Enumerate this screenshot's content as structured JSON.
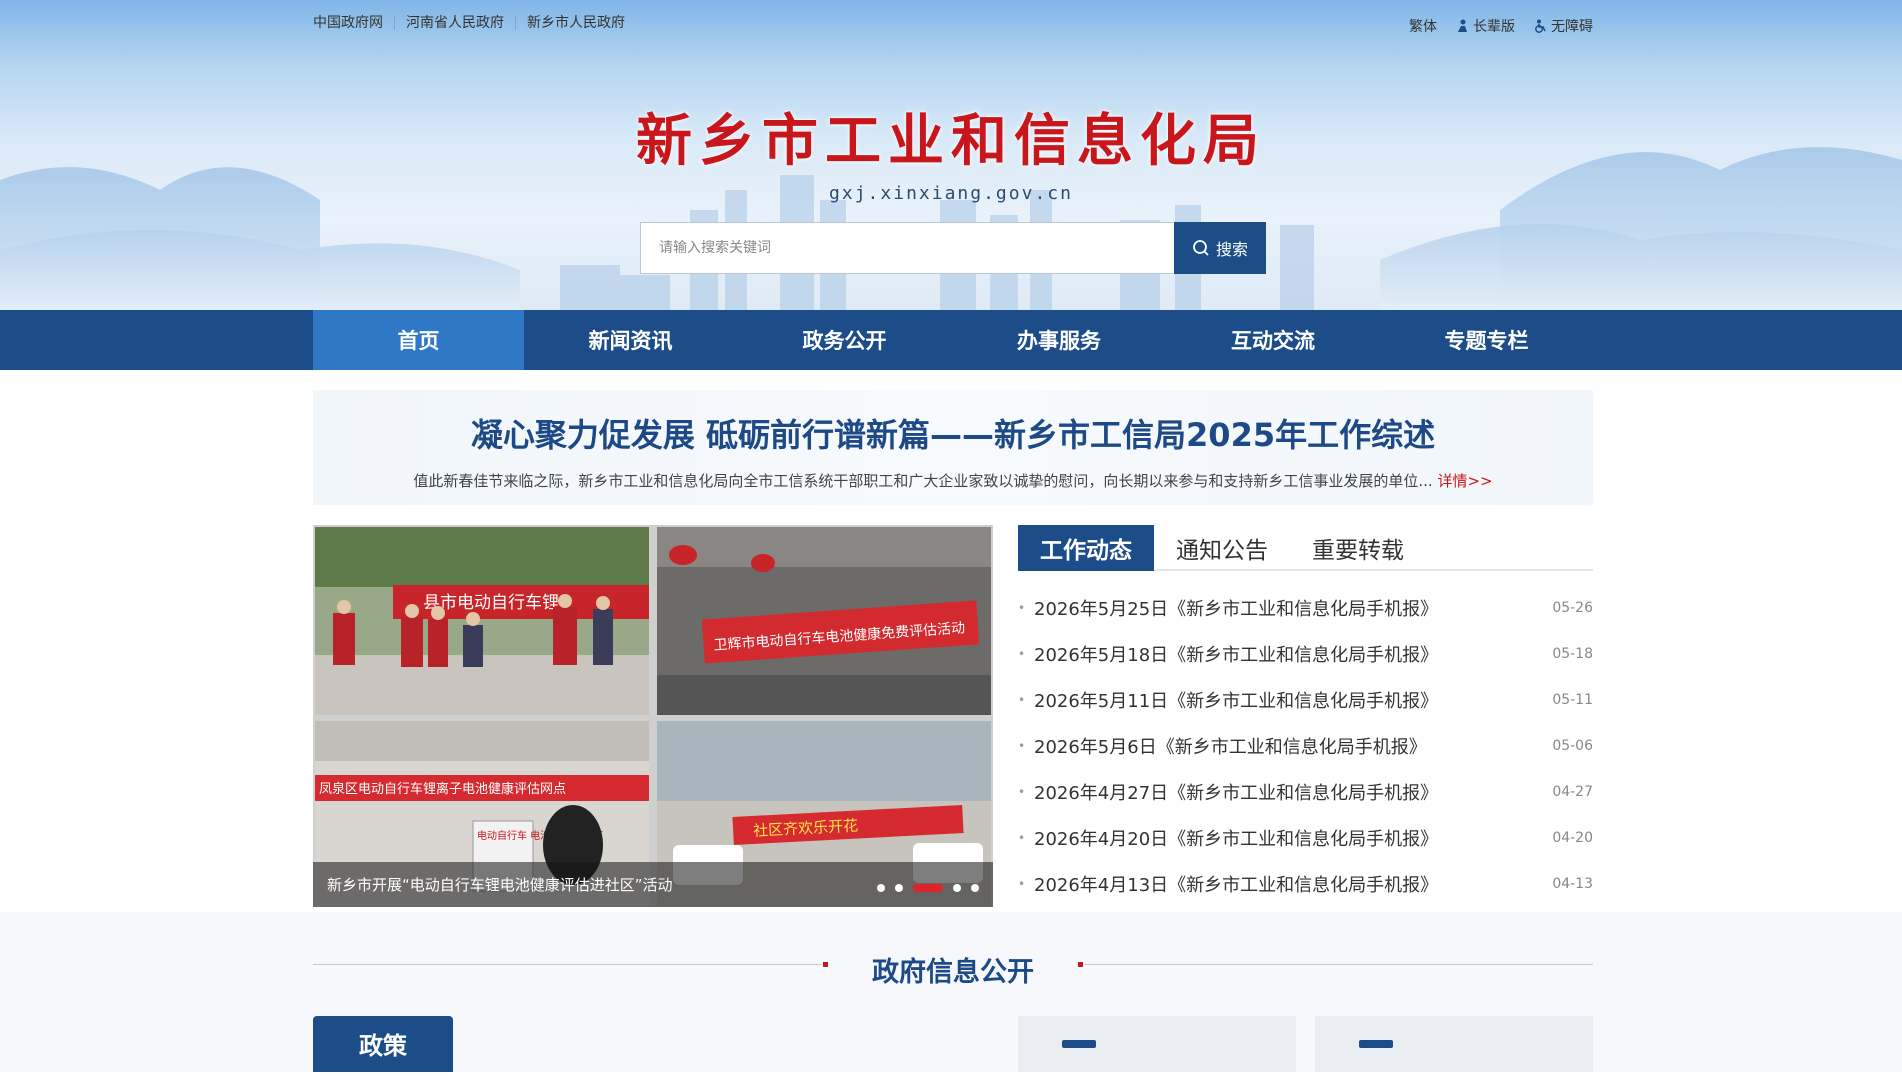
{
  "topbar": {
    "links": [
      "中国政府网",
      "河南省人民政府",
      "新乡市人民政府"
    ],
    "traditional": "繁体",
    "elder_mode": "长辈版",
    "accessibility": "无障碍"
  },
  "brand": {
    "title": "新乡市工业和信息化局",
    "domain": "gxj.xinxiang.gov.cn"
  },
  "search": {
    "placeholder": "请输入搜索关键词",
    "button": "搜索"
  },
  "nav": [
    "首页",
    "新闻资讯",
    "政务公开",
    "办事服务",
    "互动交流",
    "专题专栏"
  ],
  "headline": {
    "title": "凝心聚力促发展 砥砺前行谱新篇——新乡市工信局2025年工作综述",
    "summary": "值此新春佳节来临之际，新乡市工业和信息化局向全市工信系统干部职工和广大企业家致以诚挚的慰问，向长期以来参与和支持新乡工信事业发展的单位...",
    "more": "详情>>"
  },
  "carousel": {
    "caption": "新乡市开展“电动自行车锂电池健康评估进社区”活动",
    "photo_signs": [
      "县市电动自行车锂",
      "卫辉市电动自行车电池健康免费评估活动",
      "凤泉区电动自行车锂离子电池健康评估网点",
      "电动自行车 电池免费 检测点",
      "社区齐欢乐开花"
    ],
    "slide_count": 5,
    "active_slide": 3
  },
  "news": {
    "tabs": [
      "工作动态",
      "通知公告",
      "重要转载"
    ],
    "items": [
      {
        "title": "2026年5月25日《新乡市工业和信息化局手机报》",
        "date": "05-26"
      },
      {
        "title": "2026年5月18日《新乡市工业和信息化局手机报》",
        "date": "05-18"
      },
      {
        "title": "2026年5月11日《新乡市工业和信息化局手机报》",
        "date": "05-11"
      },
      {
        "title": "2026年5月6日《新乡市工业和信息化局手机报》",
        "date": "05-06"
      },
      {
        "title": "2026年4月27日《新乡市工业和信息化局手机报》",
        "date": "04-27"
      },
      {
        "title": "2026年4月20日《新乡市工业和信息化局手机报》",
        "date": "04-20"
      },
      {
        "title": "2026年4月13日《新乡市工业和信息化局手机报》",
        "date": "04-13"
      }
    ]
  },
  "info": {
    "title": "政府信息公开",
    "policy_tab": "政策"
  },
  "colors": {
    "brand_red": "#c8161d",
    "nav_blue": "#1d4d89",
    "nav_active": "#2f78c6"
  }
}
